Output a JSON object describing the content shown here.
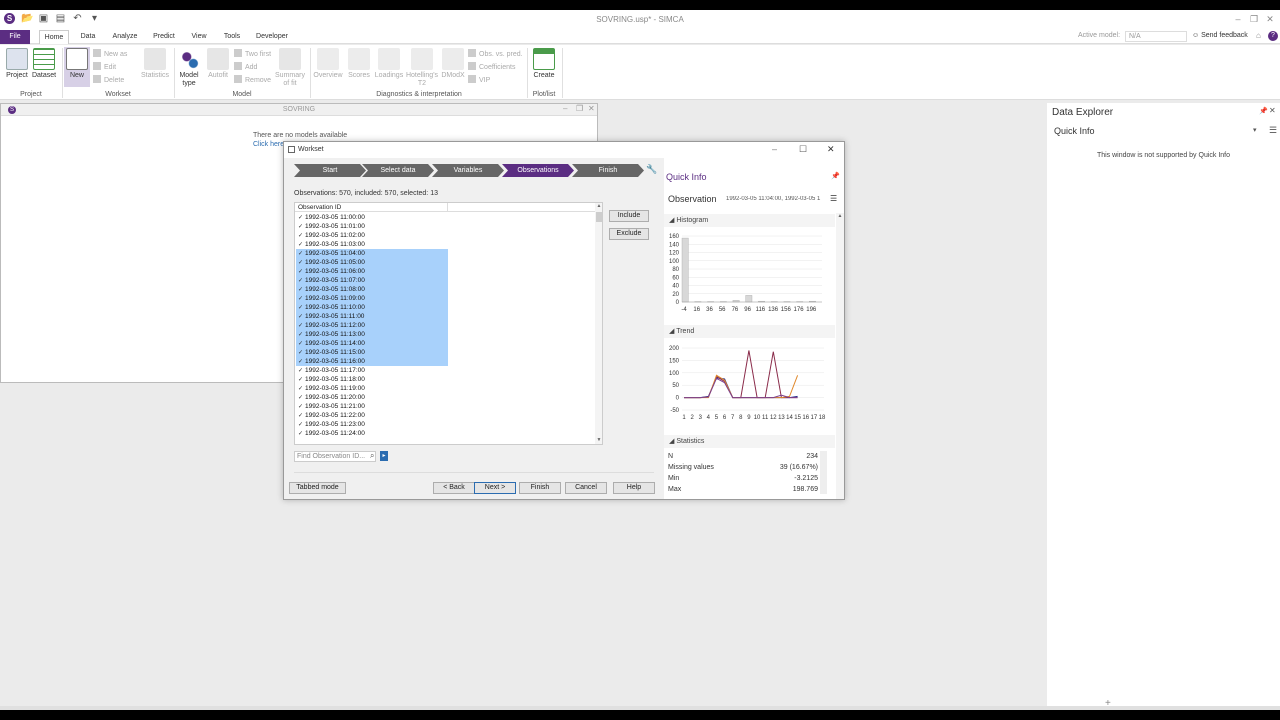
{
  "app": {
    "title": "SOVRING.usp* - SIMCA",
    "active_model_label": "Active model:",
    "active_model_value": "N/A",
    "send_feedback": "Send feedback"
  },
  "menu": {
    "tabs": [
      "File",
      "Home",
      "Data",
      "Analyze",
      "Predict",
      "View",
      "Tools",
      "Developer"
    ],
    "active": "Home"
  },
  "ribbon": {
    "project_items": [
      "Project",
      "Dataset"
    ],
    "project_group": "Project",
    "workset_new": "New",
    "workset_small": [
      "New as",
      "Edit",
      "Delete"
    ],
    "workset_statistics": "Statistics",
    "workset_group": "Workset",
    "model_type": "Model type",
    "model_autofit": "Autofit",
    "model_small": [
      "Two first",
      "Add",
      "Remove"
    ],
    "model_summary": "Summary of fit",
    "model_group": "Model",
    "diag_items": [
      "Overview",
      "Scores",
      "Loadings",
      "Hotelling's T2",
      "DModX"
    ],
    "diag_small": [
      "Obs. vs. pred.",
      "Coefficients",
      "VIP"
    ],
    "diag_group": "Diagnostics & interpretation",
    "create": "Create",
    "plot_group": "Plot/list"
  },
  "doc_window": {
    "title": "SOVRING",
    "message": "There are no models available",
    "link": "Click here"
  },
  "dialog": {
    "title": "Workset",
    "steps": [
      "Start",
      "Select data",
      "Variables",
      "Observations",
      "Finish"
    ],
    "current_step": "Observations",
    "summary": "Observations: 570, included: 570, selected: 13",
    "list_header": "Observation ID",
    "observations": [
      {
        "id": "1992-03-05 11:00:00",
        "selected": false
      },
      {
        "id": "1992-03-05 11:01:00",
        "selected": false
      },
      {
        "id": "1992-03-05 11:02:00",
        "selected": false
      },
      {
        "id": "1992-03-05 11:03:00",
        "selected": false
      },
      {
        "id": "1992-03-05 11:04:00",
        "selected": true
      },
      {
        "id": "1992-03-05 11:05:00",
        "selected": true
      },
      {
        "id": "1992-03-05 11:06:00",
        "selected": true
      },
      {
        "id": "1992-03-05 11:07:00",
        "selected": true
      },
      {
        "id": "1992-03-05 11:08:00",
        "selected": true
      },
      {
        "id": "1992-03-05 11:09:00",
        "selected": true
      },
      {
        "id": "1992-03-05 11:10:00",
        "selected": true
      },
      {
        "id": "1992-03-05 11:11:00",
        "selected": true
      },
      {
        "id": "1992-03-05 11:12:00",
        "selected": true
      },
      {
        "id": "1992-03-05 11:13:00",
        "selected": true
      },
      {
        "id": "1992-03-05 11:14:00",
        "selected": true
      },
      {
        "id": "1992-03-05 11:15:00",
        "selected": true
      },
      {
        "id": "1992-03-05 11:16:00",
        "selected": true
      },
      {
        "id": "1992-03-05 11:17:00",
        "selected": false
      },
      {
        "id": "1992-03-05 11:18:00",
        "selected": false
      },
      {
        "id": "1992-03-05 11:19:00",
        "selected": false
      },
      {
        "id": "1992-03-05 11:20:00",
        "selected": false
      },
      {
        "id": "1992-03-05 11:21:00",
        "selected": false
      },
      {
        "id": "1992-03-05 11:22:00",
        "selected": false
      },
      {
        "id": "1992-03-05 11:23:00",
        "selected": false
      },
      {
        "id": "1992-03-05 11:24:00",
        "selected": false
      }
    ],
    "include": "Include",
    "exclude": "Exclude",
    "find_placeholder": "Find Observation ID...",
    "tabbed_mode": "Tabbed mode",
    "back": "< Back",
    "next": "Next >",
    "finish": "Finish",
    "cancel": "Cancel",
    "help": "Help"
  },
  "quick_info": {
    "title": "Quick Info",
    "observation_label": "Observation",
    "observation_value": "1992-03-05 11:04:00, 1992-03-05 1",
    "histogram_label": "Histogram",
    "trend_label": "Trend",
    "statistics_label": "Statistics",
    "stats": [
      {
        "name": "N",
        "value": "234"
      },
      {
        "name": "Missing values",
        "value": "39 (16.67%)"
      },
      {
        "name": "Min",
        "value": "-3.2125"
      },
      {
        "name": "Max",
        "value": "198.769"
      }
    ]
  },
  "chart_data": [
    {
      "type": "bar",
      "categories": [
        "-4",
        "16",
        "36",
        "56",
        "76",
        "96",
        "116",
        "136",
        "156",
        "176",
        "196"
      ],
      "values": [
        155,
        1,
        1,
        1,
        4,
        16,
        2,
        1,
        1,
        1,
        2
      ],
      "ylim": [
        0,
        160
      ],
      "yticks": [
        "160",
        "140",
        "120",
        "100",
        "80",
        "60",
        "40",
        "20",
        "0"
      ]
    },
    {
      "type": "line",
      "x": [
        "1",
        "2",
        "3",
        "4",
        "5",
        "6",
        "7",
        "8",
        "9",
        "10",
        "11",
        "12",
        "13",
        "14",
        "15",
        "16",
        "17",
        "18"
      ],
      "ylim": [
        -50,
        200
      ],
      "yticks": [
        "200",
        "150",
        "100",
        "50",
        "0",
        "-50"
      ],
      "series": [
        {
          "color": "#2b2f8a",
          "values": [
            0,
            0,
            0,
            5,
            80,
            75,
            0,
            0,
            0,
            0,
            0,
            0,
            0,
            0,
            5,
            null,
            null,
            null
          ]
        },
        {
          "color": "#8a2b4a",
          "values": [
            0,
            0,
            0,
            2,
            85,
            65,
            0,
            0,
            190,
            0,
            0,
            185,
            0,
            0,
            0,
            null,
            null,
            null
          ]
        },
        {
          "color": "#e0882b",
          "values": [
            0,
            0,
            0,
            0,
            90,
            70,
            0,
            0,
            0,
            0,
            0,
            0,
            0,
            5,
            90,
            null,
            null,
            null
          ]
        },
        {
          "color": "#7a3f8f",
          "values": [
            0,
            0,
            0,
            3,
            78,
            60,
            0,
            0,
            0,
            0,
            0,
            0,
            10,
            0,
            0,
            null,
            null,
            null
          ]
        }
      ]
    }
  ],
  "right_panel": {
    "title": "Data Explorer",
    "subtitle": "Quick Info",
    "message": "This window is not supported by Quick Info"
  }
}
